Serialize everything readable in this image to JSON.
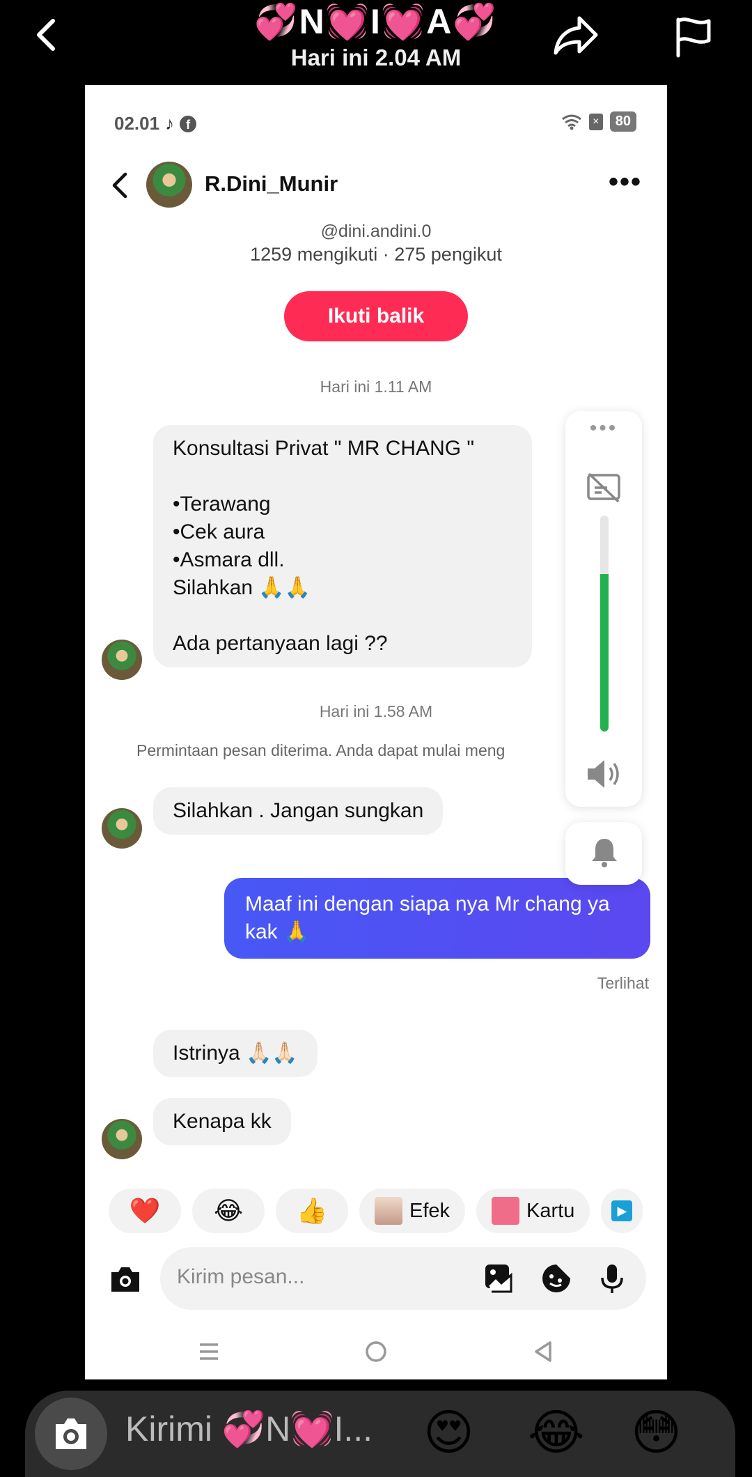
{
  "outer": {
    "title": "💞N💓I💓A💞",
    "subtitle": "Hari ini 2.04 AM",
    "compose_placeholder": "Kirimi 💞N💓I...",
    "emojis": [
      "😍",
      "😂",
      "😳"
    ]
  },
  "status_bar": {
    "time": "02.01",
    "battery": "80"
  },
  "chat": {
    "name": "R.Dini_Munir",
    "handle": "@dini.andini.0",
    "counts": "1259 mengikuti · 275 pengikut",
    "follow_button": "Ikuti balik",
    "timestamp1": "Hari ini 1.11 AM",
    "timestamp2": "Hari ini 1.58 AM",
    "system_note": "Permintaan pesan diterima. Anda dapat mulai meng",
    "seen": "Terlihat",
    "messages": [
      {
        "from": "in",
        "text": "Konsultasi Privat \" MR CHANG \"\n\n•Terawang\n•Cek aura\n•Asmara dll.\nSilahkan 🙏🙏\n\nAda pertanyaan lagi ??"
      },
      {
        "from": "in",
        "text": "Silahkan . Jangan sungkan"
      },
      {
        "from": "out",
        "text": "Maaf ini dengan siapa nya Mr chang ya kak 🙏"
      },
      {
        "from": "in",
        "text": "Istrinya 🙏🏻🙏🏻"
      },
      {
        "from": "in",
        "text": "Kenapa kk"
      }
    ]
  },
  "volume": {
    "level": 0.73,
    "accent": "#23b14d"
  },
  "quick_replies": [
    {
      "type": "emoji",
      "label": "❤️"
    },
    {
      "type": "emoji",
      "label": "😂"
    },
    {
      "type": "emoji",
      "label": "👍"
    },
    {
      "type": "chip",
      "label": "Efek"
    },
    {
      "type": "chip",
      "label": "Kartu"
    }
  ],
  "composer": {
    "placeholder": "Kirim pesan..."
  },
  "colors": {
    "follow": "#fe2c55",
    "outgoing": "#4758f5"
  }
}
